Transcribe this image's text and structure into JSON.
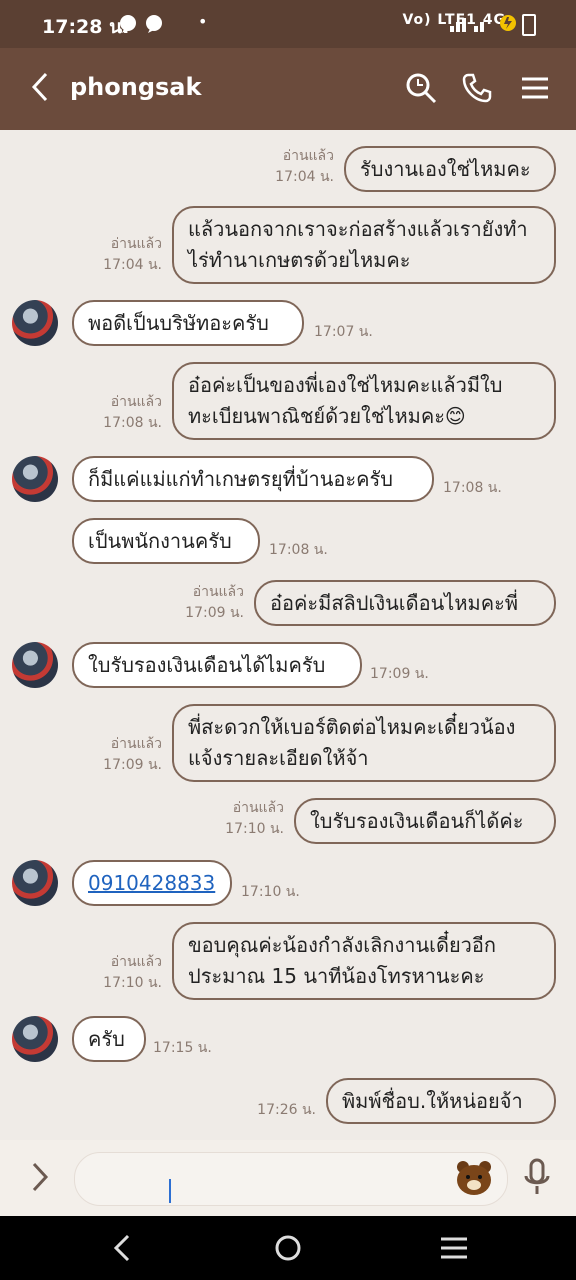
{
  "status_bar": {
    "time": "17:28 น.",
    "dot": "•",
    "right_label": "Vo) LTE1 4G"
  },
  "header": {
    "contact_name": "phongsak"
  },
  "messages": [
    {
      "dir": "out",
      "text": "รับงานเองใช่ไหมคะ",
      "read": "อ่านแล้ว",
      "time": "17:04 น."
    },
    {
      "dir": "out",
      "text": "แล้วนอกจากเราจะก่อสร้างแล้วเรายังทำไร่ทำนาเกษตรด้วยไหมคะ",
      "read": "อ่านแล้ว",
      "time": "17:04 น."
    },
    {
      "dir": "in",
      "text": "พอดีเป็นบริษัทอะครับ",
      "time": "17:07 น."
    },
    {
      "dir": "out",
      "text": "อ๋อค่ะเป็นของพี่เองใช่ไหมคะแล้วมีใบทะเบียนพาณิชย์ด้วยใช่ไหมคะ😊",
      "read": "อ่านแล้ว",
      "time": "17:08 น."
    },
    {
      "dir": "in",
      "text": "ก็มีแค่แม่แก่ทำเกษตรยุที่บ้านอะครับ",
      "time": "17:08 น."
    },
    {
      "dir": "in",
      "text": "เป็นพนักงานครับ",
      "time": "17:08 น."
    },
    {
      "dir": "out",
      "text": "อ๋อค่ะมีสลิปเงินเดือนไหมคะพี่",
      "read": "อ่านแล้ว",
      "time": "17:09 น."
    },
    {
      "dir": "in",
      "text": "ใบรับรองเงินเดือนได้ไมครับ",
      "time": "17:09 น."
    },
    {
      "dir": "out",
      "text": "พี่สะดวกให้เบอร์ติดต่อไหมคะเดี๋ยวน้องแจ้งรายละเอียดให้จ้า",
      "read": "อ่านแล้ว",
      "time": "17:09 น."
    },
    {
      "dir": "out",
      "text": "ใบรับรองเงินเดือนก็ได้ค่ะ",
      "read": "อ่านแล้ว",
      "time": "17:10 น."
    },
    {
      "dir": "in",
      "text": "0910428833",
      "time": "17:10 น.",
      "link": true
    },
    {
      "dir": "out",
      "text": "ขอบคุณค่ะน้องกำลังเลิกงานเดี๋ยวอีกประมาณ 15 นาทีน้องโทรหานะคะ",
      "read": "อ่านแล้ว",
      "time": "17:10 น."
    },
    {
      "dir": "in",
      "text": "ครับ",
      "time": "17:15 น."
    },
    {
      "dir": "out",
      "text": "พิมพ์ชื่อบ.ให้หน่อยจ้า",
      "time": "17:26 น."
    }
  ],
  "input": {
    "placeholder": ""
  },
  "icons": {
    "back": "chevron-left-icon",
    "search": "search-icon",
    "call": "phone-icon",
    "menu": "menu-icon",
    "expand": "chevron-right-icon",
    "sticker": "sticker-bear-icon",
    "mic": "microphone-icon",
    "nav_back": "nav-back-icon",
    "nav_home": "nav-home-icon",
    "nav_recents": "nav-recents-icon"
  }
}
